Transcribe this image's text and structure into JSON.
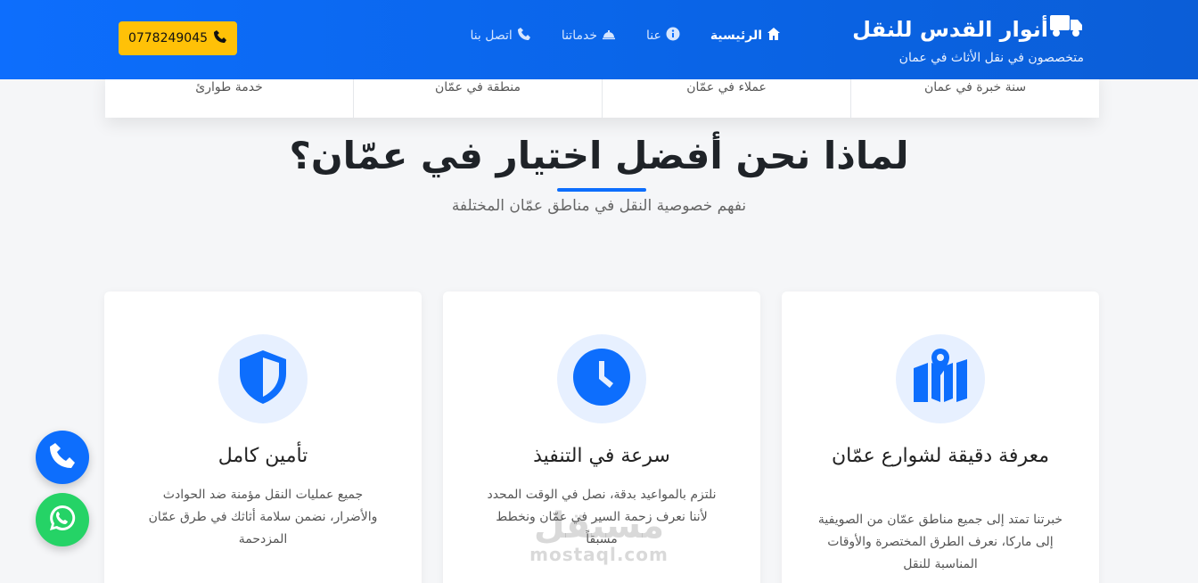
{
  "header": {
    "brand_title": "أنوار القدس للنقل",
    "brand_subtitle": "متخصصون في نقل الأثاث في عمان",
    "nav": [
      {
        "label": "الرئيسية",
        "icon": "home-icon"
      },
      {
        "label": "عنا",
        "icon": "info-icon"
      },
      {
        "label": "خدماتنا",
        "icon": "service-bell-icon"
      },
      {
        "label": "اتصل بنا",
        "icon": "phone-icon"
      }
    ],
    "phone": "0778249045"
  },
  "stats": [
    {
      "label": "سنة خبرة في عمان"
    },
    {
      "label": "عملاء في عمّان"
    },
    {
      "label": "منطقة في عمّان"
    },
    {
      "label": "خدمة طوارئ"
    }
  ],
  "section": {
    "title": "لماذا نحن أفضل اختيار في عمّان؟",
    "subtitle": "نفهم خصوصية النقل في مناطق عمّان المختلفة"
  },
  "cards": [
    {
      "icon": "map-location-icon",
      "title": "معرفة دقيقة لشوارع عمّان",
      "text": "خبرتنا تمتد إلى جميع مناطق عمّان من الصويفية إلى ماركا، نعرف الطرق المختصرة والأوقات المناسبة للنقل"
    },
    {
      "icon": "clock-icon",
      "title": "سرعة في التنفيذ",
      "text": "نلتزم بالمواعيد بدقة، نصل في الوقت المحدد لأننا نعرف زحمة السير في عمّان ونخطط مسبقاً"
    },
    {
      "icon": "shield-icon",
      "title": "تأمين كامل",
      "text": "جميع عمليات النقل مؤمنة ضد الحوادث والأضرار، نضمن سلامة أثاثك في طرق عمّان المزدحمة"
    }
  ],
  "watermark": {
    "ar": "مستقل",
    "en": "mostaql.com"
  },
  "colors": {
    "primary": "#0d6efd",
    "accent": "#ffc107",
    "whatsapp": "#25d366"
  }
}
